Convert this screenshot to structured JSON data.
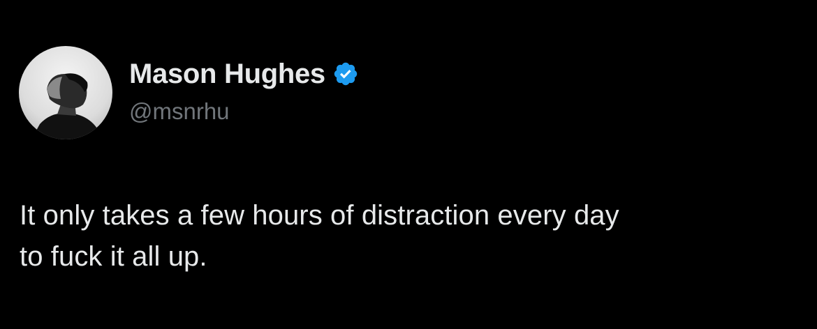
{
  "tweet": {
    "author": {
      "display_name": "Mason Hughes",
      "handle": "@msnrhu",
      "verified": true,
      "verified_icon": "verified-badge-icon",
      "avatar": "grayscale-profile-photo"
    },
    "text": "It only takes a few hours of distraction every day\nto fuck it all up."
  },
  "colors": {
    "background": "#000000",
    "primary_text": "#e7e9ea",
    "secondary_text": "#71767b",
    "verified_badge": "#1d9bf0"
  }
}
